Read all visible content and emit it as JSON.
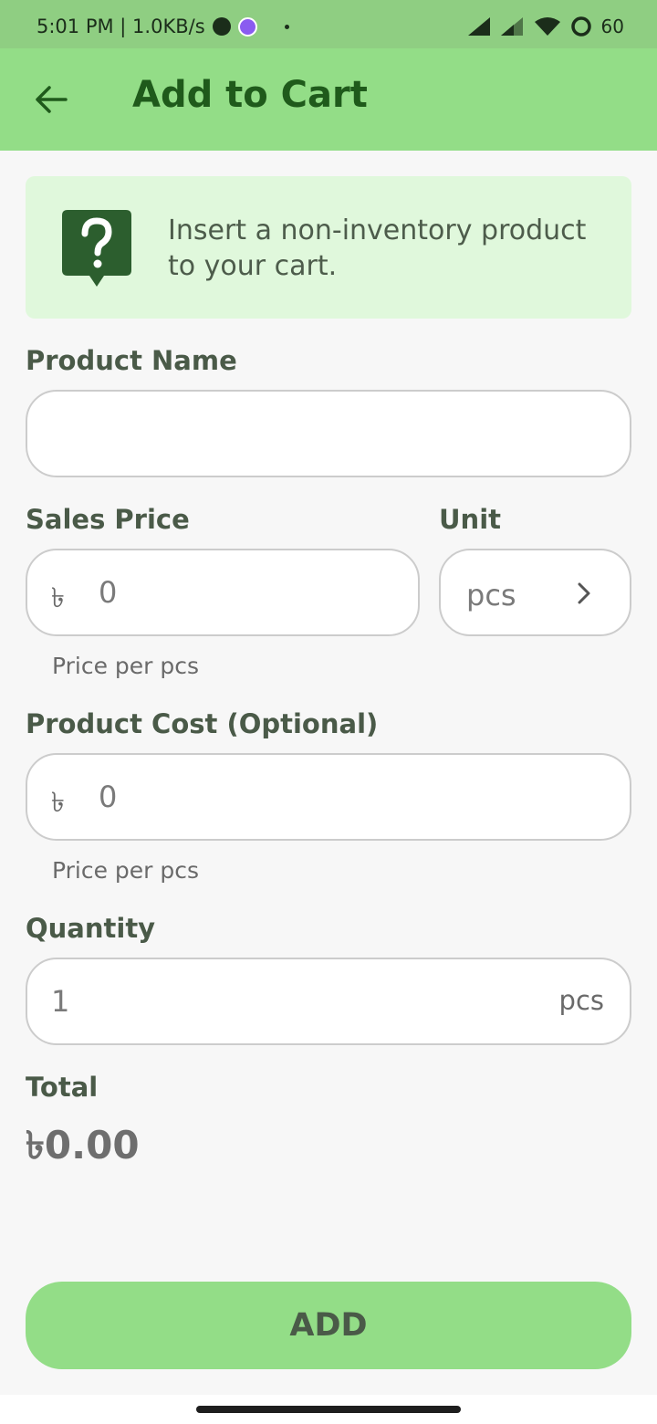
{
  "status_bar": {
    "time_speed": "5:01 PM | 1.0KB/s",
    "battery": "60"
  },
  "header": {
    "title": "Add to Cart"
  },
  "info": {
    "message": "Insert a non-inventory product to your cart."
  },
  "form": {
    "product_name_label": "Product Name",
    "product_name_value": "",
    "sales_price_label": "Sales Price",
    "sales_price_currency": "৳",
    "sales_price_value": "0",
    "sales_price_helper": "Price per pcs",
    "unit_label": "Unit",
    "unit_value": "pcs",
    "product_cost_label": "Product Cost (Optional)",
    "product_cost_currency": "৳",
    "product_cost_value": "0",
    "product_cost_helper": "Price per pcs",
    "quantity_label": "Quantity",
    "quantity_value": "1",
    "quantity_unit": "pcs",
    "total_label": "Total",
    "total_value": "৳0.00"
  },
  "actions": {
    "add_label": "ADD"
  },
  "colors": {
    "app_bar": "#93dd87",
    "status_bar": "#8fce82",
    "title_text": "#1f5a1b",
    "banner_bg": "#e0f8dc",
    "icon_dark": "#2c5e2e"
  }
}
